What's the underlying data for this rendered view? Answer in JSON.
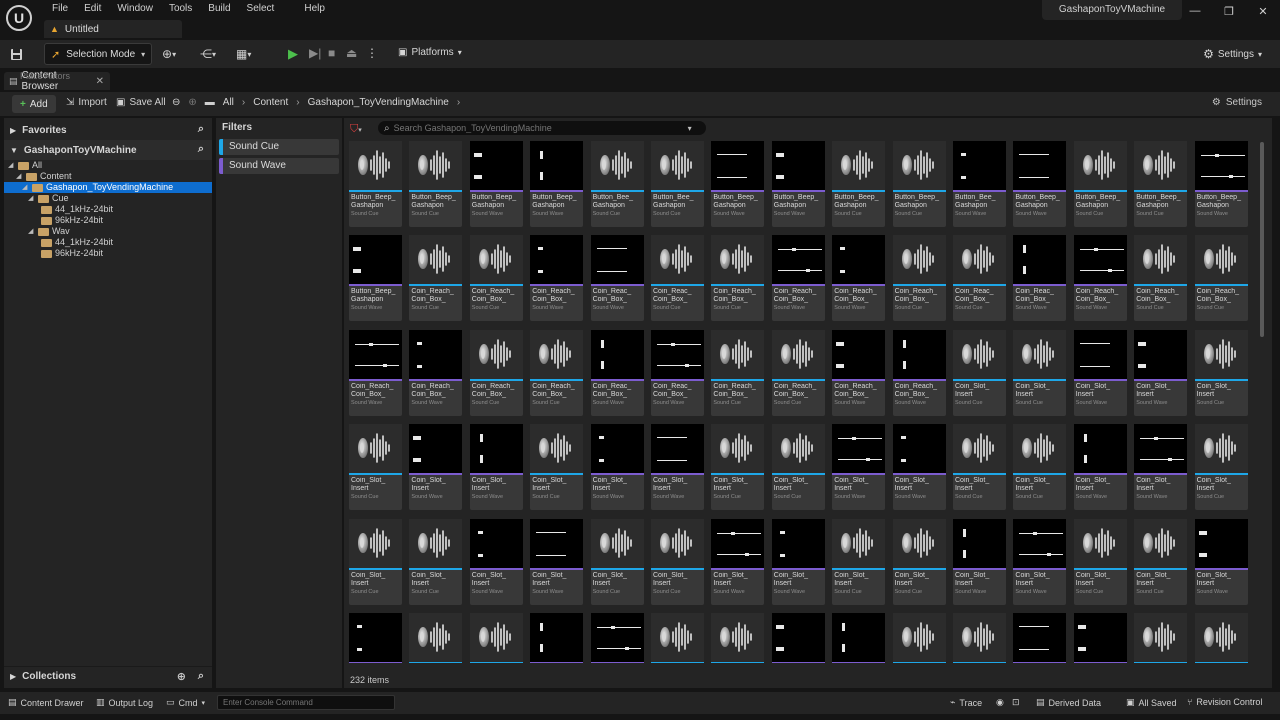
{
  "titlebar": {
    "logo": "U",
    "menus": [
      "File",
      "Edit",
      "Window",
      "Tools",
      "Build",
      "Select",
      "Help"
    ],
    "doc_tab": "Untitled",
    "project_tab": "GashaponToyVMachine",
    "window_controls": [
      "—",
      "❐",
      "✕"
    ]
  },
  "toolbar": {
    "save_icon": "save-icon",
    "selection_mode": "Selection Mode",
    "platforms": "Platforms",
    "settings": "Settings"
  },
  "content_browser": {
    "tab_label": "Content Browser",
    "tab_ghost": "Place Actors",
    "add": "Add",
    "import": "Import",
    "save_all": "Save All",
    "breadcrumbs": [
      "All",
      "Content",
      "Gashapon_ToyVendingMachine"
    ],
    "settings": "Settings"
  },
  "left_panel": {
    "favorites": "Favorites",
    "project": "GashaponToyVMachine",
    "tree": [
      {
        "label": "All",
        "depth": 0
      },
      {
        "label": "Content",
        "depth": 1
      },
      {
        "label": "Gashapon_ToyVendingMachine",
        "depth": 2,
        "selected": true
      },
      {
        "label": "Cue",
        "depth": 3
      },
      {
        "label": "44_1kHz-24bit",
        "depth": 4
      },
      {
        "label": "96kHz-24bit",
        "depth": 4
      },
      {
        "label": "Wav",
        "depth": 3
      },
      {
        "label": "44_1kHz-24bit",
        "depth": 4
      },
      {
        "label": "96kHz-24bit",
        "depth": 4
      }
    ],
    "collections": "Collections"
  },
  "filters": {
    "title": "Filters",
    "items": [
      {
        "label": "Sound Cue",
        "color": "#1ea7e8"
      },
      {
        "label": "Sound Wave",
        "color": "#7c5ccf"
      }
    ]
  },
  "assets": {
    "search_placeholder": "Search Gashapon_ToyVendingMachine",
    "item_count": "232 items",
    "colors": {
      "cue": "#1ea7e8",
      "wave": "#7c5ccf"
    },
    "type_labels": {
      "cue": "Sound Cue",
      "wave": "Sound Wave"
    },
    "rows": [
      [
        [
          "c",
          "Button_Beep_",
          "Gashapon"
        ],
        [
          "c",
          "Button_Beep_",
          "Gashapon"
        ],
        [
          "w",
          "Button_Beep_",
          "Gashapon"
        ],
        [
          "w",
          "Button_Beep_",
          "Gashapon"
        ],
        [
          "c",
          "Button_Bee_",
          "Gashapon"
        ],
        [
          "c",
          "Button_Bee_",
          "Gashapon"
        ],
        [
          "w",
          "Button_Beep_",
          "Gashapon"
        ],
        [
          "w",
          "Button_Beep_",
          "Gashapon"
        ],
        [
          "c",
          "Button_Beep_",
          "Gashapon"
        ],
        [
          "c",
          "Button_Beep_",
          "Gashapon"
        ],
        [
          "w",
          "Button_Bee_",
          "Gashapon"
        ],
        [
          "w",
          "Button_Beep_",
          "Gashapon"
        ],
        [
          "c",
          "Button_Beep_",
          "Gashapon"
        ],
        [
          "c",
          "Button_Beep_",
          "Gashapon"
        ],
        [
          "w",
          "Button_Beep_",
          "Gashapon"
        ]
      ],
      [
        [
          "w",
          "Button_Beep_",
          "Gashapon"
        ],
        [
          "c",
          "Coin_Reach_",
          "Coin_Box_"
        ],
        [
          "c",
          "Coin_Reach_",
          "Coin_Box_"
        ],
        [
          "w",
          "Coin_Reach_",
          "Coin_Box_"
        ],
        [
          "w",
          "Coin_Reac_",
          "Coin_Box_"
        ],
        [
          "c",
          "Coin_Reac_",
          "Coin_Box_"
        ],
        [
          "c",
          "Coin_Reach_",
          "Coin_Box_"
        ],
        [
          "w",
          "Coin_Reach_",
          "Coin_Box_"
        ],
        [
          "w",
          "Coin_Reach_",
          "Coin_Box_"
        ],
        [
          "c",
          "Coin_Reach_",
          "Coin_Box_"
        ],
        [
          "c",
          "Coin_Reac_",
          "Coin_Box_"
        ],
        [
          "w",
          "Coin_Reac_",
          "Coin_Box_"
        ],
        [
          "w",
          "Coin_Reach_",
          "Coin_Box_"
        ],
        [
          "c",
          "Coin_Reach_",
          "Coin_Box_"
        ],
        [
          "c",
          "Coin_Reach_",
          "Coin_Box_"
        ]
      ],
      [
        [
          "w",
          "Coin_Reach_",
          "Coin_Box_"
        ],
        [
          "w",
          "Coin_Reach_",
          "Coin_Box_"
        ],
        [
          "c",
          "Coin_Reach_",
          "Coin_Box_"
        ],
        [
          "c",
          "Coin_Reach_",
          "Coin_Box_"
        ],
        [
          "w",
          "Coin_Reac_",
          "Coin_Box_"
        ],
        [
          "w",
          "Coin_Reac_",
          "Coin_Box_"
        ],
        [
          "c",
          "Coin_Reach_",
          "Coin_Box_"
        ],
        [
          "c",
          "Coin_Reach_",
          "Coin_Box_"
        ],
        [
          "w",
          "Coin_Reach_",
          "Coin_Box_"
        ],
        [
          "w",
          "Coin_Reach_",
          "Coin_Box_"
        ],
        [
          "c",
          "Coin_Slot_",
          "Insert"
        ],
        [
          "c",
          "Coin_Slot_",
          "Insert"
        ],
        [
          "w",
          "Coin_Slot_",
          "Insert"
        ],
        [
          "w",
          "Coin_Slot_",
          "Insert"
        ],
        [
          "c",
          "Coin_Slot_",
          "Insert"
        ]
      ],
      [
        [
          "c",
          "Coin_Slot_",
          "Insert"
        ],
        [
          "w",
          "Coin_Slot_",
          "Insert"
        ],
        [
          "w",
          "Coin_Slot_",
          "Insert"
        ],
        [
          "c",
          "Coin_Slot_",
          "Insert"
        ],
        [
          "w",
          "Coin_Slot_",
          "Insert"
        ],
        [
          "w",
          "Coin_Slot_",
          "Insert"
        ],
        [
          "c",
          "Coin_Slot_",
          "Insert"
        ],
        [
          "c",
          "Coin_Slot_",
          "Insert"
        ],
        [
          "w",
          "Coin_Slot_",
          "Insert"
        ],
        [
          "w",
          "Coin_Slot_",
          "Insert"
        ],
        [
          "c",
          "Coin_Slot_",
          "Insert"
        ],
        [
          "c",
          "Coin_Slot_",
          "Insert"
        ],
        [
          "w",
          "Coin_Slot_",
          "Insert"
        ],
        [
          "w",
          "Coin_Slot_",
          "Insert"
        ],
        [
          "c",
          "Coin_Slot_",
          "Insert"
        ]
      ],
      [
        [
          "c",
          "Coin_Slot_",
          "Insert"
        ],
        [
          "c",
          "Coin_Slot_",
          "Insert"
        ],
        [
          "w",
          "Coin_Slot_",
          "Insert"
        ],
        [
          "w",
          "Coin_Slot_",
          "Insert"
        ],
        [
          "c",
          "Coin_Slot_",
          "Insert"
        ],
        [
          "c",
          "Coin_Slot_",
          "Insert"
        ],
        [
          "w",
          "Coin_Slot_",
          "Insert"
        ],
        [
          "w",
          "Coin_Slot_",
          "Insert"
        ],
        [
          "c",
          "Coin_Slot_",
          "Insert"
        ],
        [
          "c",
          "Coin_Slot_",
          "Insert"
        ],
        [
          "w",
          "Coin_Slot_",
          "Insert"
        ],
        [
          "w",
          "Coin_Slot_",
          "Insert"
        ],
        [
          "c",
          "Coin_Slot_",
          "Insert"
        ],
        [
          "c",
          "Coin_Slot_",
          "Insert"
        ],
        [
          "w",
          "Coin_Slot_",
          "Insert"
        ]
      ],
      [
        [
          "w",
          "",
          ""
        ],
        [
          "c",
          "",
          ""
        ],
        [
          "c",
          "",
          ""
        ],
        [
          "w",
          "",
          ""
        ],
        [
          "w",
          "",
          ""
        ],
        [
          "c",
          "",
          ""
        ],
        [
          "c",
          "",
          ""
        ],
        [
          "w",
          "",
          ""
        ],
        [
          "w",
          "",
          ""
        ],
        [
          "c",
          "",
          ""
        ],
        [
          "c",
          "",
          ""
        ],
        [
          "w",
          "",
          ""
        ],
        [
          "w",
          "",
          ""
        ],
        [
          "c",
          "",
          ""
        ],
        [
          "c",
          "",
          ""
        ]
      ]
    ]
  },
  "statusbar": {
    "content_drawer": "Content Drawer",
    "output_log": "Output Log",
    "cmd": "Cmd",
    "console_placeholder": "Enter Console Command",
    "trace": "Trace",
    "derived_data": "Derived Data",
    "all_saved": "All Saved",
    "revision_control": "Revision Control"
  }
}
